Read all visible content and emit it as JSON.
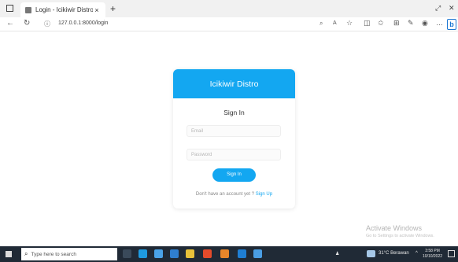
{
  "browser": {
    "tab_title": "Login - Icikiwir Distro",
    "tab_close": "×",
    "new_tab": "+",
    "url": "127.0.0.1:8000/login"
  },
  "page": {
    "brand": "Icikiwir Distro",
    "form_title": "Sign In",
    "email_placeholder": "Email",
    "password_placeholder": "Password",
    "submit_label": "Sign In",
    "signup_prompt": "Don't have an account yet ?",
    "signup_link": "Sign Up"
  },
  "watermark": {
    "title": "Activate Windows",
    "subtitle": "Go to Settings to activate Windows."
  },
  "taskbar": {
    "search_placeholder": "Type here to search",
    "weather": "31°C Berawan",
    "time": "3:58 PM",
    "date": "10/10/2022"
  },
  "colors": {
    "accent": "#13a7f1",
    "taskbar": "#202a36"
  }
}
